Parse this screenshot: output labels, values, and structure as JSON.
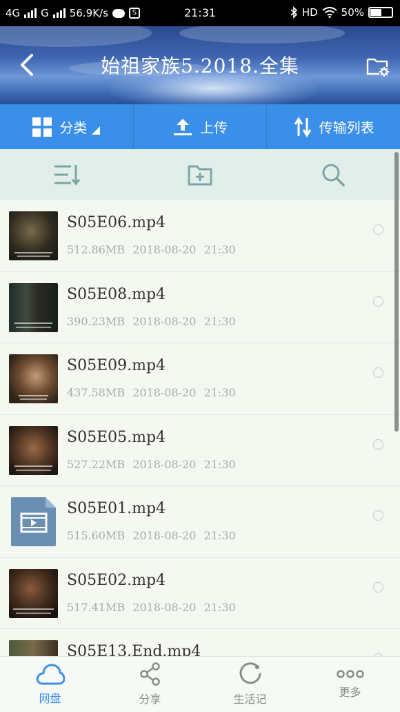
{
  "status_bar": {
    "network_4g": "4G",
    "network_g": "G",
    "speed": "56.9K/s",
    "s_badge": "S",
    "time": "21:31",
    "hd": "HD",
    "battery_text": "50%",
    "battery_level": 0.5
  },
  "header": {
    "title": "始祖家族5.2018.全集",
    "back_icon": "chevron-left-icon",
    "folder_settings_icon": "folder-settings-icon"
  },
  "toolbar": {
    "category_label": "分类",
    "upload_label": "上传",
    "transfer_label": "传输列表"
  },
  "actions": {
    "sort_icon": "sort-icon",
    "new_folder_icon": "folder-add-icon",
    "search_icon": "search-icon"
  },
  "files": [
    {
      "name": "S05E06.mp4",
      "size": "512.86MB",
      "date": "2018-08-20",
      "time": "21:30",
      "thumb": "video-frame"
    },
    {
      "name": "S05E08.mp4",
      "size": "390.23MB",
      "date": "2018-08-20",
      "time": "21:30",
      "thumb": "video-frame"
    },
    {
      "name": "S05E09.mp4",
      "size": "437.58MB",
      "date": "2018-08-20",
      "time": "21:30",
      "thumb": "video-frame"
    },
    {
      "name": "S05E05.mp4",
      "size": "527.22MB",
      "date": "2018-08-20",
      "time": "21:30",
      "thumb": "video-frame"
    },
    {
      "name": "S05E01.mp4",
      "size": "515.60MB",
      "date": "2018-08-20",
      "time": "21:30",
      "thumb": "video-file-icon"
    },
    {
      "name": "S05E02.mp4",
      "size": "517.41MB",
      "date": "2018-08-20",
      "time": "21:30",
      "thumb": "video-frame"
    },
    {
      "name": "S05E13.End.mp4",
      "size": "",
      "date": "",
      "time": "",
      "thumb": "video-frame"
    }
  ],
  "bottom_nav": [
    {
      "label": "网盘",
      "icon": "cloud-icon",
      "active": true
    },
    {
      "label": "分享",
      "icon": "share-icon",
      "active": false
    },
    {
      "label": "生活记",
      "icon": "circle-refresh-icon",
      "active": false
    },
    {
      "label": "更多",
      "icon": "more-dots-icon",
      "active": false
    }
  ],
  "colors": {
    "accent": "#3a8fe8",
    "action_bar_bg": "#e1eeea",
    "list_bg": "#f4f8f1",
    "meta_text": "#a8aca6",
    "icon_muted": "#7fa4a6"
  }
}
